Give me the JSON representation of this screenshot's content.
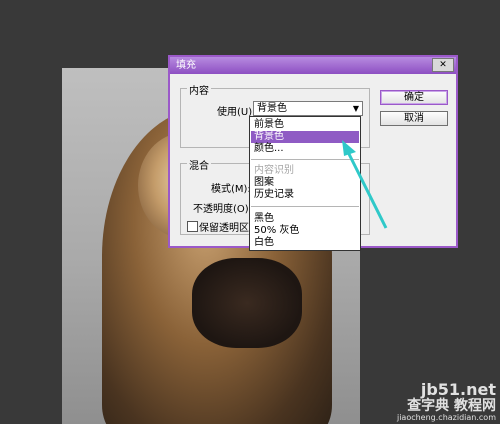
{
  "dialog": {
    "title": "填充",
    "close_icon": "close-icon",
    "confirm_label": "确定",
    "cancel_label": "取消",
    "content_group": {
      "title": "内容",
      "use_label": "使用(U):",
      "use_value": "背景色"
    },
    "blend_group": {
      "title": "混合",
      "mode_label": "模式(M):",
      "opacity_label": "不透明度(O):",
      "preserve_label": "保留透明区域"
    }
  },
  "dropdown": {
    "options": [
      {
        "label": "前景色",
        "state": "normal"
      },
      {
        "label": "背景色",
        "state": "selected"
      },
      {
        "label": "颜色...",
        "state": "normal"
      },
      {
        "label": "内容识别",
        "state": "disabled"
      },
      {
        "label": "图案",
        "state": "normal"
      },
      {
        "label": "历史记录",
        "state": "normal"
      },
      {
        "label": "黑色",
        "state": "normal"
      },
      {
        "label": "50% 灰色",
        "state": "normal"
      },
      {
        "label": "白色",
        "state": "normal"
      }
    ]
  },
  "annotation": {
    "color": "#2fc9c9"
  },
  "watermark": {
    "site": "jb51.net",
    "brand": "查字典 教程网",
    "url": "jiaocheng.chazidian.com"
  },
  "colors": {
    "dialog_accent": "#9b59c9",
    "selected_bg": "#8f5bc4"
  }
}
